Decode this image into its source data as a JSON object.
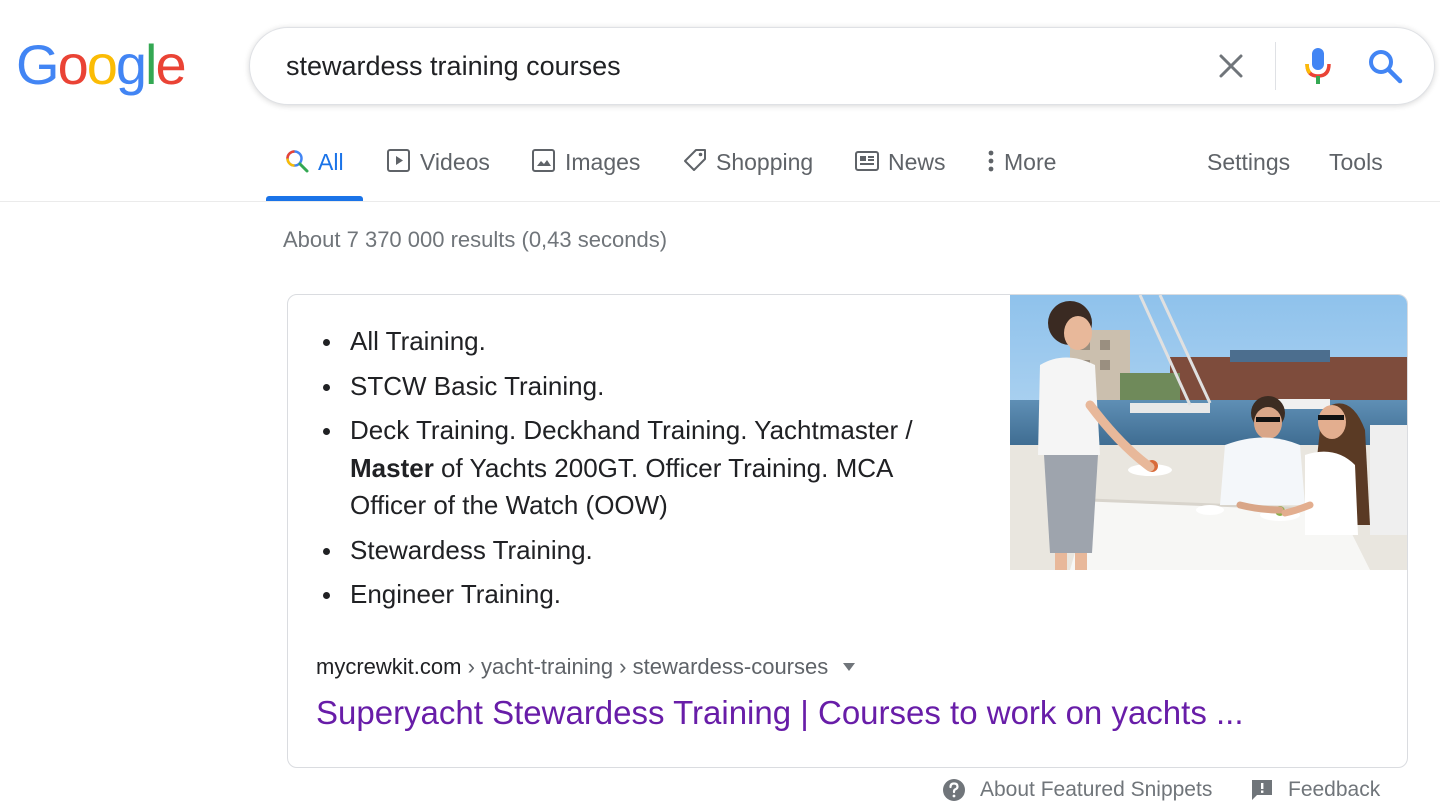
{
  "logo": {
    "letters": [
      "G",
      "o",
      "o",
      "g",
      "l",
      "e"
    ],
    "colors": [
      "#4285F4",
      "#EA4335",
      "#FBBC05",
      "#4285F4",
      "#34A853",
      "#EA4335"
    ]
  },
  "search": {
    "query": "stewardess training courses"
  },
  "icons": {
    "clear": "close-icon",
    "mic": "microphone-icon",
    "search": "search-icon"
  },
  "tabs": [
    {
      "label": "All",
      "icon": "search-icon",
      "active": true
    },
    {
      "label": "Videos",
      "icon": "play-icon"
    },
    {
      "label": "Images",
      "icon": "image-icon"
    },
    {
      "label": "Shopping",
      "icon": "tag-icon"
    },
    {
      "label": "News",
      "icon": "newspaper-icon"
    },
    {
      "label": "More",
      "icon": "more-vertical-icon"
    }
  ],
  "tools": {
    "settings": "Settings",
    "tools": "Tools"
  },
  "result_stats": "About 7 370 000 results (0,43 seconds)",
  "snippet": {
    "items": [
      "All Training.",
      "STCW Basic Training.",
      "Deck Training. Deckhand Training. Yachtmaster / ",
      "Stewardess Training.",
      "Engineer Training."
    ],
    "item3_bold": "Master",
    "item3_rest": " of Yachts 200GT. Officer Training. MCA Officer of the Watch (OOW)",
    "breadcrumb": {
      "domain": "mycrewkit.com",
      "path": " › yacht-training › stewardess-courses"
    },
    "title": "Superyacht Stewardess Training | Courses to work on yachts ..."
  },
  "footer": {
    "about": "About Featured Snippets",
    "feedback": "Feedback"
  },
  "colors": {
    "accent": "#1a73e8",
    "visited_link": "#681da8",
    "muted": "#70757a"
  }
}
